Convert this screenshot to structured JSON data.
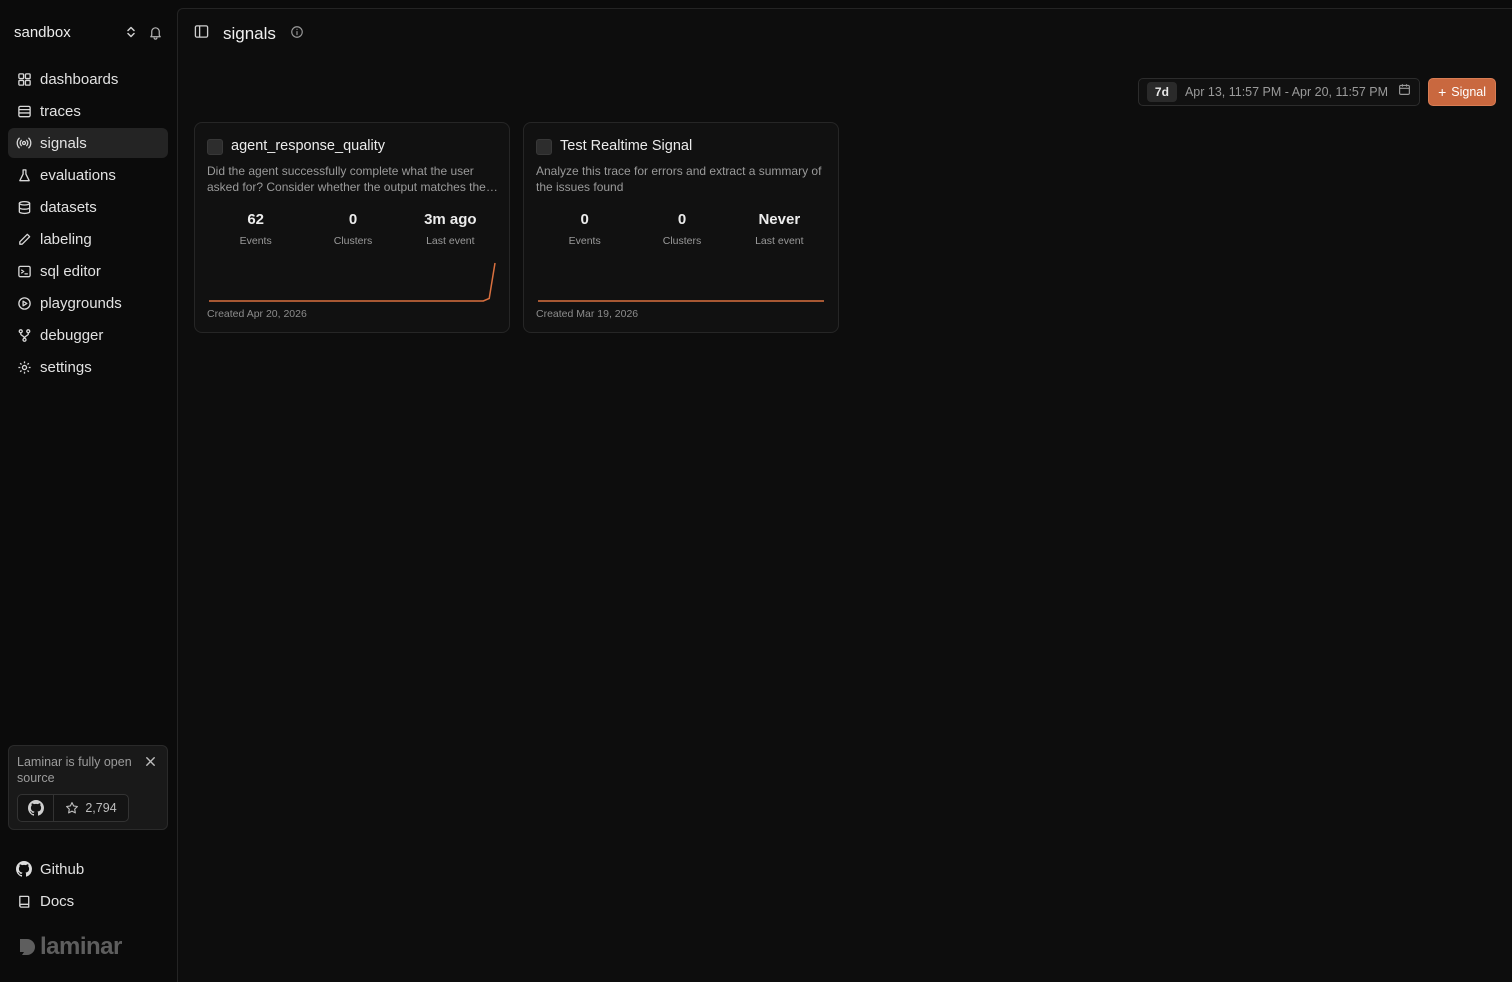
{
  "sidebar": {
    "workspace": "sandbox",
    "nav": [
      {
        "label": "dashboards",
        "icon": "grid-icon",
        "active": false
      },
      {
        "label": "traces",
        "icon": "rows-icon",
        "active": false
      },
      {
        "label": "signals",
        "icon": "broadcast-icon",
        "active": true
      },
      {
        "label": "evaluations",
        "icon": "flask-icon",
        "active": false
      },
      {
        "label": "datasets",
        "icon": "database-icon",
        "active": false
      },
      {
        "label": "labeling",
        "icon": "pen-icon",
        "active": false
      },
      {
        "label": "sql editor",
        "icon": "terminal-icon",
        "active": false
      },
      {
        "label": "playgrounds",
        "icon": "play-circle-icon",
        "active": false
      },
      {
        "label": "debugger",
        "icon": "git-branch-icon",
        "active": false
      },
      {
        "label": "settings",
        "icon": "gear-icon",
        "active": false
      }
    ],
    "promo": {
      "text": "Laminar is fully open source",
      "stars": "2,794"
    },
    "footer": [
      {
        "label": "Github",
        "icon": "github-icon"
      },
      {
        "label": "Docs",
        "icon": "book-icon"
      }
    ],
    "logo": "laminar"
  },
  "header": {
    "title": "signals"
  },
  "toolbar": {
    "range_badge": "7d",
    "range_text": "Apr 13, 11:57 PM - Apr 20, 11:57 PM",
    "signal_button": "Signal"
  },
  "colors": {
    "accent": "#c9683f",
    "spark": "#d9703f"
  },
  "cards": [
    {
      "title": "agent_response_quality",
      "description": "Did the agent successfully complete what the user asked for? Consider whether the output matches the user's request and intent.",
      "events": "62",
      "events_label": "Events",
      "clusters": "0",
      "clusters_label": "Clusters",
      "last_event": "3m ago",
      "last_event_label": "Last event",
      "created": "Created Apr 20, 2026",
      "trend": [
        0,
        0,
        0,
        0,
        0,
        0,
        0,
        0,
        0,
        0,
        0,
        0,
        0,
        0,
        0,
        0,
        0,
        0,
        0,
        0,
        0,
        0,
        0,
        0,
        0,
        0,
        0,
        0,
        0,
        0,
        0,
        0,
        0,
        0,
        0,
        0,
        0,
        0,
        0,
        0,
        0,
        0,
        0,
        0,
        0,
        0,
        0,
        0,
        2,
        31
      ]
    },
    {
      "title": "Test Realtime Signal",
      "description": "Analyze this trace for errors and extract a summary of the issues found",
      "events": "0",
      "events_label": "Events",
      "clusters": "0",
      "clusters_label": "Clusters",
      "last_event": "Never",
      "last_event_label": "Last event",
      "created": "Created Mar 19, 2026",
      "trend": [
        0,
        0,
        0,
        0,
        0,
        0,
        0,
        0,
        0,
        0
      ]
    }
  ]
}
